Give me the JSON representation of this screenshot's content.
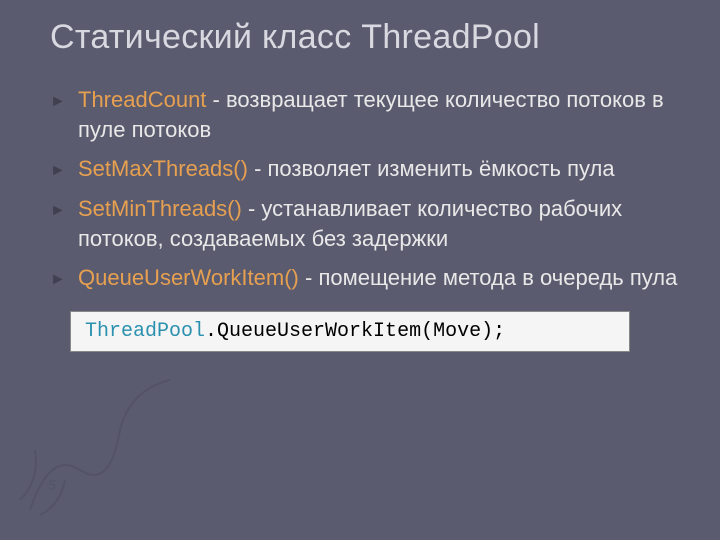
{
  "title": "Статический класс ThreadPool",
  "bullets": [
    {
      "term": "ThreadCount",
      "sep": " - ",
      "desc": "возвращает текущее количество потоков в пуле потоков"
    },
    {
      "term": "SetMaxThreads() ",
      "sep": " - ",
      "desc": "позволяет изменить ёмкость пула"
    },
    {
      "term": " SetMinThreads() ",
      "sep": " - ",
      "desc": "устанавливает количество рабочих потоков, создаваемых без задержки"
    },
    {
      "term": "QueueUserWorkItem() ",
      "sep": " - ",
      "desc": "помещение метода в очередь пула"
    }
  ],
  "code": {
    "class": "ThreadPool",
    "rest": ".QueueUserWorkItem(Move);"
  }
}
